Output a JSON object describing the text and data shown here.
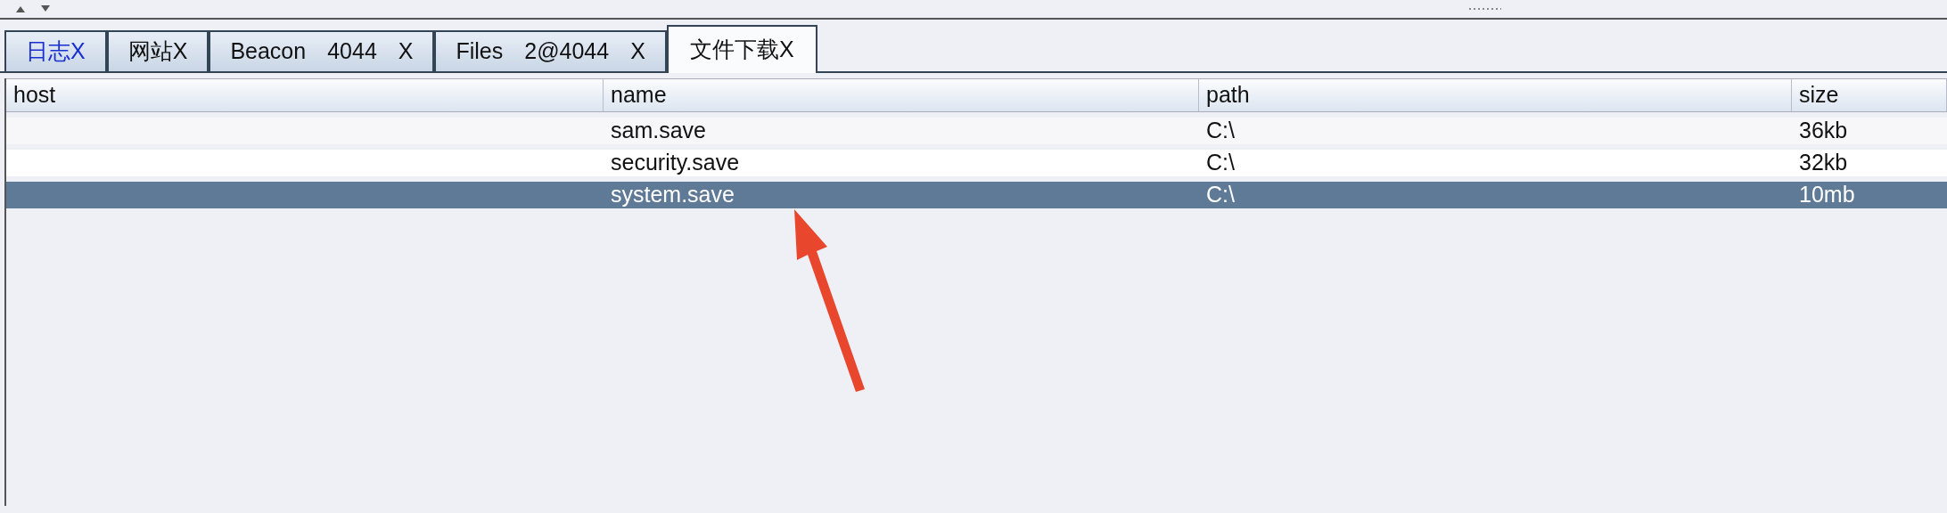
{
  "tabs": [
    {
      "parts": [
        "日志X"
      ],
      "selected": false,
      "accent": true
    },
    {
      "parts": [
        "网站X"
      ],
      "selected": false,
      "accent": false
    },
    {
      "parts": [
        "Beacon",
        "4044",
        "X"
      ],
      "selected": false,
      "accent": false
    },
    {
      "parts": [
        "Files",
        "2@4044",
        "X"
      ],
      "selected": false,
      "accent": false
    },
    {
      "parts": [
        "文件下载X"
      ],
      "selected": true,
      "accent": false
    }
  ],
  "table": {
    "columns": [
      "host",
      "name",
      "path",
      "size"
    ],
    "rows": [
      {
        "cells": [
          "",
          "sam.save",
          "C:\\",
          "36kb"
        ],
        "selected": false
      },
      {
        "cells": [
          "",
          "security.save",
          "C:\\",
          "32kb"
        ],
        "selected": false
      },
      {
        "cells": [
          "",
          "system.save",
          "C:\\",
          "10mb"
        ],
        "selected": true
      }
    ]
  }
}
